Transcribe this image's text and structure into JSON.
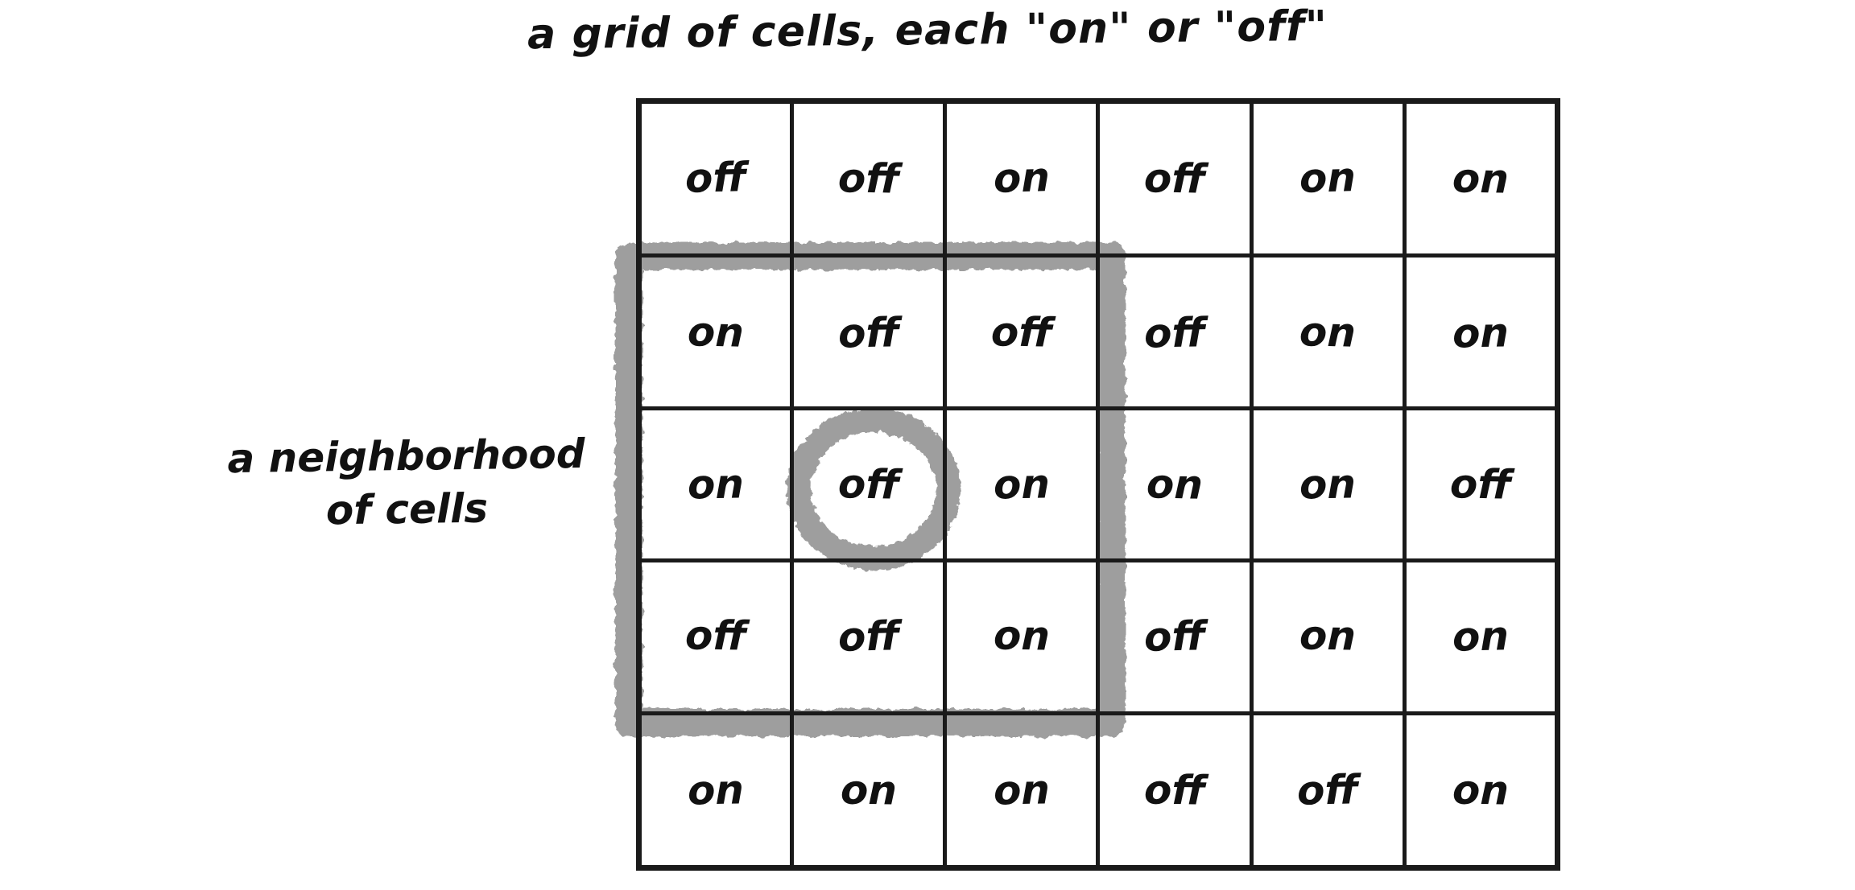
{
  "title": "a grid of cells, each \"on\" or \"off\"",
  "left_caption": {
    "line1": "a neighborhood",
    "line2": "of cells"
  },
  "colors": {
    "ink": "#1a1a1a",
    "text": "#111111",
    "highlight_gray": "#9e9e9e",
    "background": "#ffffff"
  },
  "grid": {
    "rows": 5,
    "cols": 6,
    "cells": [
      [
        "off",
        "off",
        "on",
        "off",
        "on",
        "on"
      ],
      [
        "on",
        "off",
        "off",
        "off",
        "on",
        "on"
      ],
      [
        "on",
        "off",
        "on",
        "on",
        "on",
        "off"
      ],
      [
        "off",
        "off",
        "on",
        "off",
        "on",
        "on"
      ],
      [
        "on",
        "on",
        "on",
        "off",
        "off",
        "on"
      ]
    ]
  },
  "annotations": {
    "neighborhood_box": {
      "label": "a neighborhood of cells",
      "covers_rows": [
        2,
        3,
        4
      ],
      "covers_cols": [
        1,
        2,
        3
      ]
    },
    "center_cell_circle": {
      "label": "center cell",
      "row": 3,
      "col": 2,
      "value": "off"
    }
  }
}
